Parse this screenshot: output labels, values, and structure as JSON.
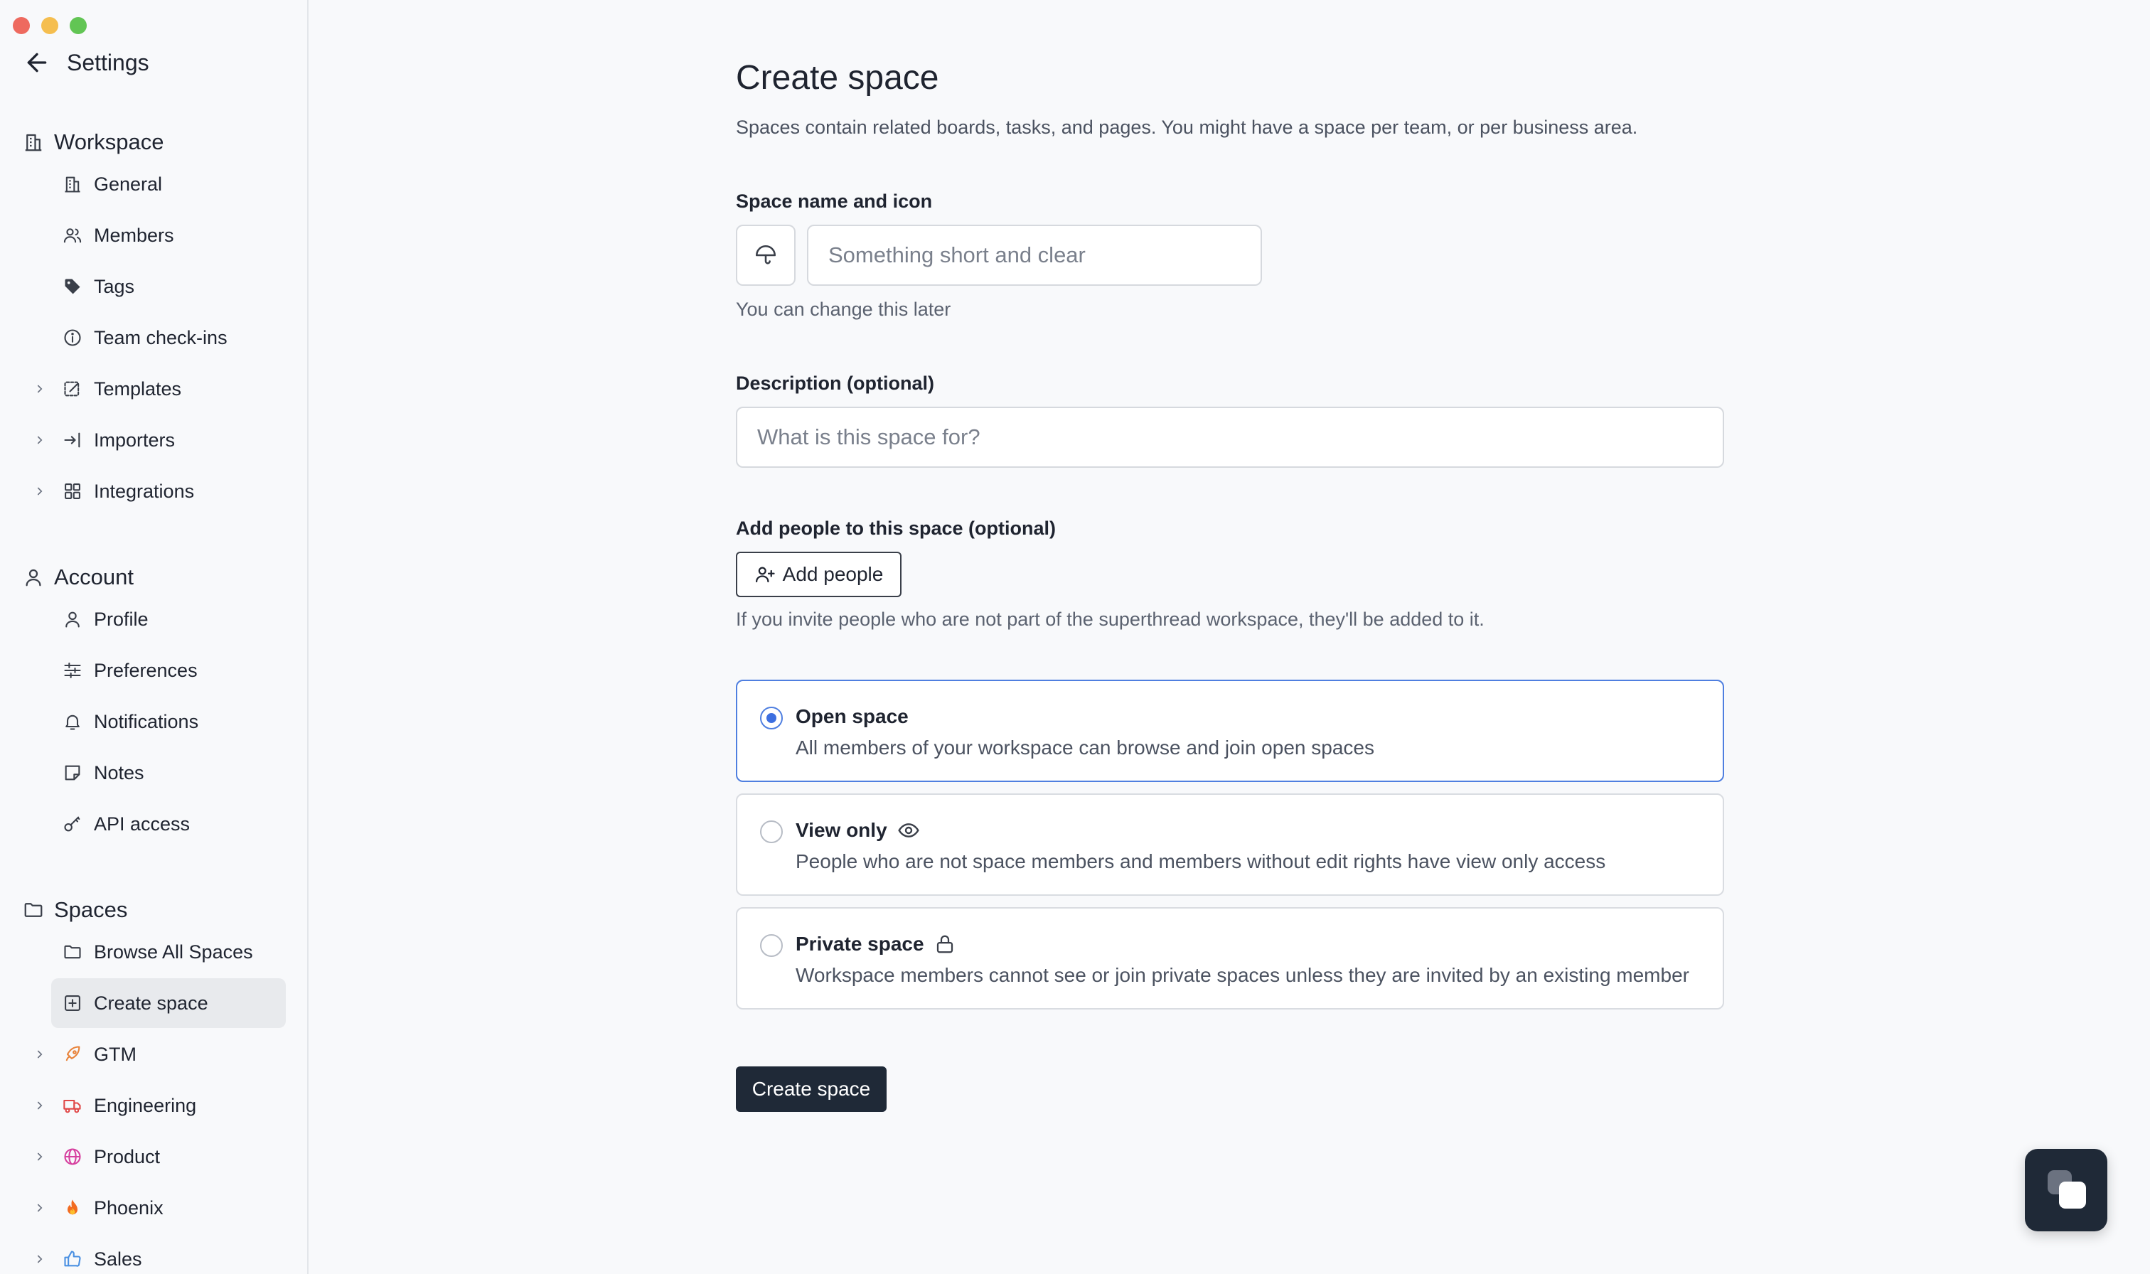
{
  "sidebar": {
    "title": "Settings",
    "workspace": {
      "label": "Workspace",
      "items": [
        {
          "label": "General",
          "icon": "building-icon"
        },
        {
          "label": "Members",
          "icon": "users-icon"
        },
        {
          "label": "Tags",
          "icon": "tag-icon"
        },
        {
          "label": "Team check-ins",
          "icon": "info-circle-icon"
        },
        {
          "label": "Templates",
          "icon": "template-icon"
        },
        {
          "label": "Importers",
          "icon": "import-icon"
        },
        {
          "label": "Integrations",
          "icon": "grid-icon"
        }
      ]
    },
    "account": {
      "label": "Account",
      "items": [
        {
          "label": "Profile",
          "icon": "user-icon"
        },
        {
          "label": "Preferences",
          "icon": "sliders-icon"
        },
        {
          "label": "Notifications",
          "icon": "bell-icon"
        },
        {
          "label": "Notes",
          "icon": "note-icon"
        },
        {
          "label": "API access",
          "icon": "key-icon"
        }
      ]
    },
    "spaces": {
      "label": "Spaces",
      "items": [
        {
          "label": "Browse All Spaces",
          "icon": "folder-icon"
        },
        {
          "label": "Create space",
          "icon": "plus-square-icon"
        },
        {
          "label": "GTM",
          "icon": "rocket-icon"
        },
        {
          "label": "Engineering",
          "icon": "truck-icon"
        },
        {
          "label": "Product",
          "icon": "globe-icon"
        },
        {
          "label": "Phoenix",
          "icon": "fire-icon"
        },
        {
          "label": "Sales",
          "icon": "thumbs-up-icon"
        }
      ]
    }
  },
  "main": {
    "title": "Create space",
    "subtitle": "Spaces contain related boards, tasks, and pages. You might have a space per team, or per business area.",
    "name_label": "Space name and icon",
    "name_placeholder": "Something short and clear",
    "name_hint": "You can change this later",
    "description_label": "Description (optional)",
    "description_placeholder": "What is this space for?",
    "people_label": "Add people to this space (optional)",
    "add_people_button": "Add people",
    "people_hint": "If you invite people who are not part of the superthread workspace, they'll be added to it.",
    "options": [
      {
        "title": "Open space",
        "description": "All members of your workspace can browse and join open spaces",
        "selected": true
      },
      {
        "title": "View only",
        "description": "People who are not space members and members without edit rights have view only access",
        "icon": "eye-icon",
        "selected": false
      },
      {
        "title": "Private space",
        "description": "Workspace members cannot see or join private spaces unless they are invited by an existing member",
        "icon": "lock-icon",
        "selected": false
      }
    ],
    "submit_button": "Create space"
  },
  "colors": {
    "accent": "#3d6fe0",
    "primary_button": "#1f2937",
    "background": "#f8f9fb"
  }
}
